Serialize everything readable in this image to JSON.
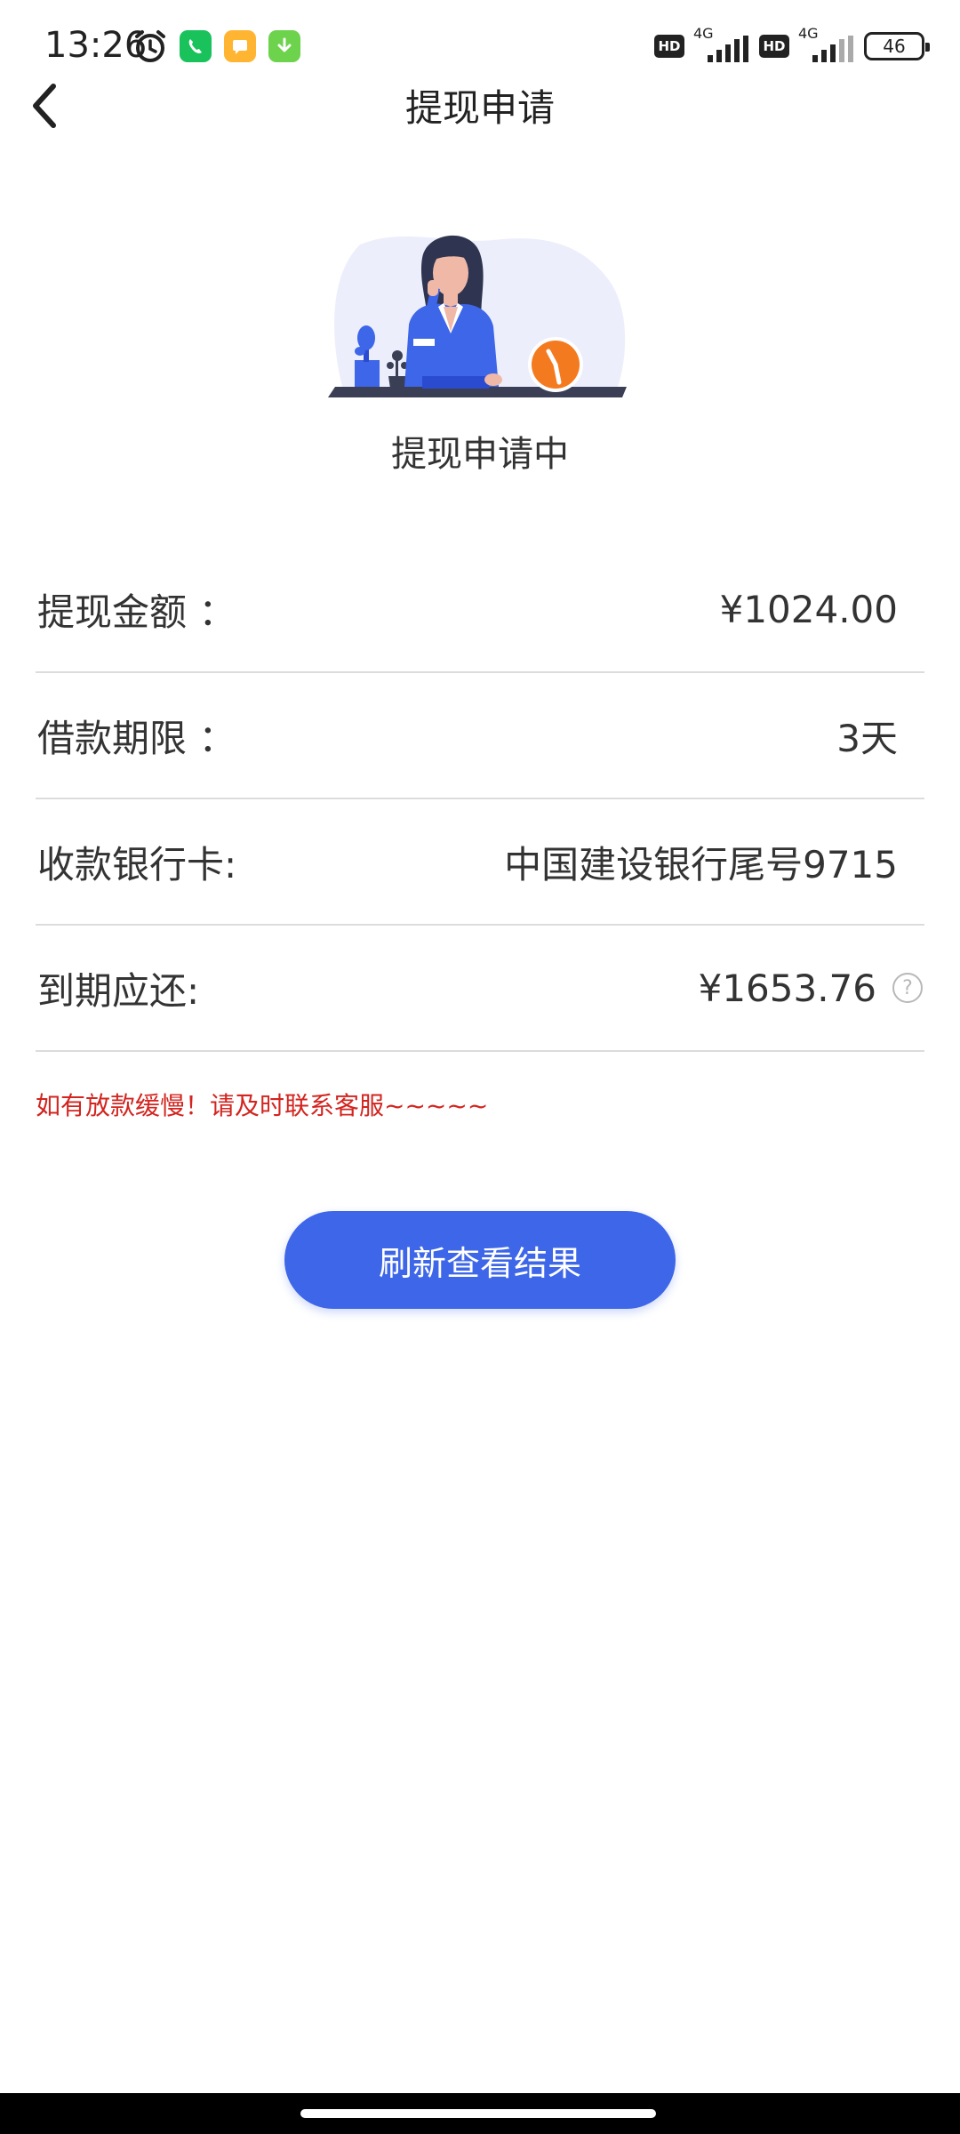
{
  "status_bar": {
    "time": "13:26",
    "network_1": "4G",
    "network_2": "4G",
    "hd_1": "HD",
    "hd_2": "HD",
    "battery": "46",
    "icons": [
      "alarm-icon",
      "phone-app-icon",
      "message-app-icon",
      "download-app-icon",
      "signal-icon",
      "battery-icon"
    ]
  },
  "header": {
    "title": "提现申请",
    "back_icon": "chevron-left-icon"
  },
  "status": {
    "heading": "提现申请中"
  },
  "info": {
    "rows": [
      {
        "label": "提现金额 ：",
        "value": "¥1024.00"
      },
      {
        "label": "借款期限 ：",
        "value": "3天"
      },
      {
        "label": "收款银行卡:",
        "value": "中国建设银行尾号9715"
      },
      {
        "label": "到期应还:",
        "value": "¥1653.76"
      }
    ],
    "help_symbol": "?"
  },
  "notice": "如有放款缓慢！请及时联系客服~~~~~",
  "refresh_button": "刷新查看结果",
  "colors": {
    "accent": "#3d66e8",
    "notice": "#d3241f",
    "divider": "#dcdcdc",
    "clock": "#f47a1f"
  }
}
